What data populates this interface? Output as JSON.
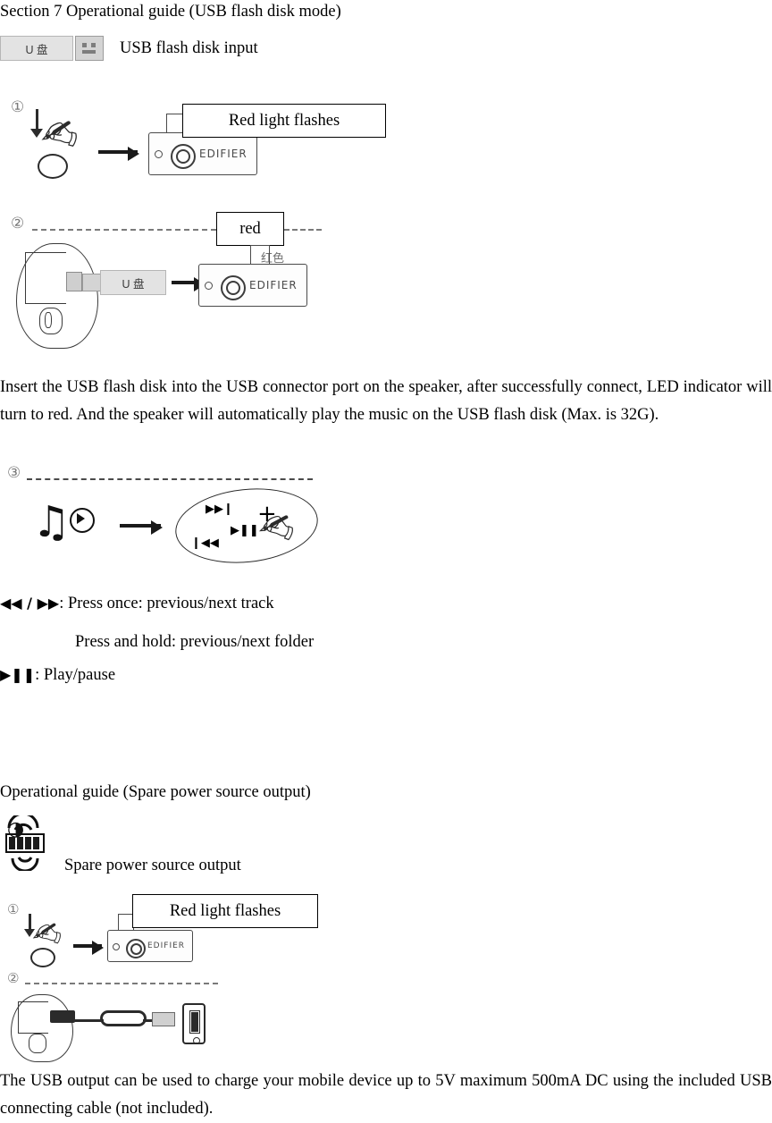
{
  "document": {
    "heading": "Section 7 Operational guide (USB flash disk mode)",
    "usb_mode": {
      "chip_label": "U 盘",
      "input_label": "USB flash disk input",
      "step1_marker": "①",
      "step1_callout": "Red light flashes",
      "step2_marker": "②",
      "step2_callout": "red",
      "step2_cn_label": "红色",
      "step2_usb_chip": "U 盘",
      "speaker_brand": "EDIFIER",
      "paragraph": "Insert the USB flash disk into the USB connector port on the speaker, after successfully connect, LED indicator will turn to red. And the speaker will automatically play the music on the USB flash disk (Max. is 32G).",
      "step3_marker": "③",
      "controls": [
        {
          "glyph": "◀◀ / ▶▶",
          "text": ": Press once: previous/next track"
        },
        {
          "glyph": "",
          "text": "Press and hold: previous/next folder"
        },
        {
          "glyph": "▶❚❚",
          "text": ": Play/pause"
        }
      ],
      "dial_labels": {
        "next": "▶▶❙",
        "prev": "❙◀◀",
        "play": "▶❚❚",
        "plus": "+"
      }
    },
    "spare_power": {
      "heading": "Operational guide (Spare power source output)",
      "label": "Spare power source output",
      "step1_marker": "①",
      "step1_callout": "Red light flashes",
      "step2_marker": "②",
      "speaker_brand": "EDIFIER",
      "paragraph": "The USB output can be used to charge your mobile device up to 5V maximum 500mA DC using the included USB connecting cable (not included)."
    }
  }
}
